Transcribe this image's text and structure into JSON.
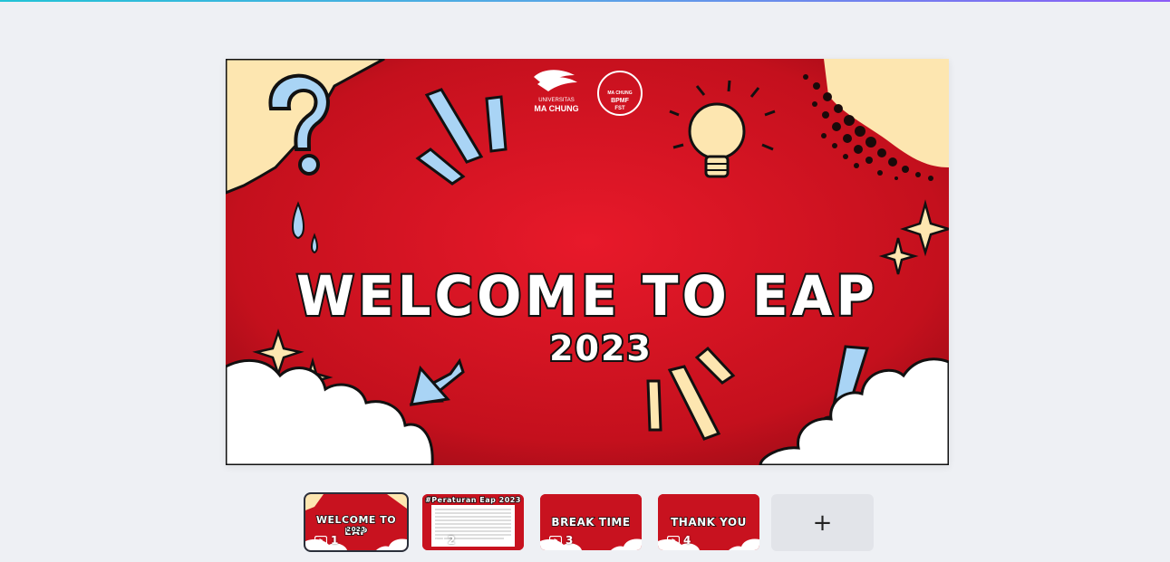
{
  "slide": {
    "title": "WELCOME TO EAP",
    "year": "2023",
    "logo_university_line1": "UNIVERSITAS",
    "logo_university_line2": "MA CHUNG",
    "logo_seal_line1": "MA CHUNG",
    "logo_seal_line2": "BPMF",
    "logo_seal_line3": "FST"
  },
  "thumbnails": [
    {
      "number": "1",
      "title": "WELCOME TO EAP",
      "subtitle": "2023",
      "active": true
    },
    {
      "number": "2",
      "title": "#Peraturan Eap 2023",
      "active": false
    },
    {
      "number": "3",
      "title": "BREAK TIME",
      "active": false
    },
    {
      "number": "4",
      "title": "THANK YOU",
      "active": false
    }
  ],
  "add_button": {
    "label": "+"
  },
  "colors": {
    "slide_red": "#c8121f",
    "cream": "#fde6b0",
    "light_blue": "#a9d4f5",
    "background": "#eef0f4"
  }
}
